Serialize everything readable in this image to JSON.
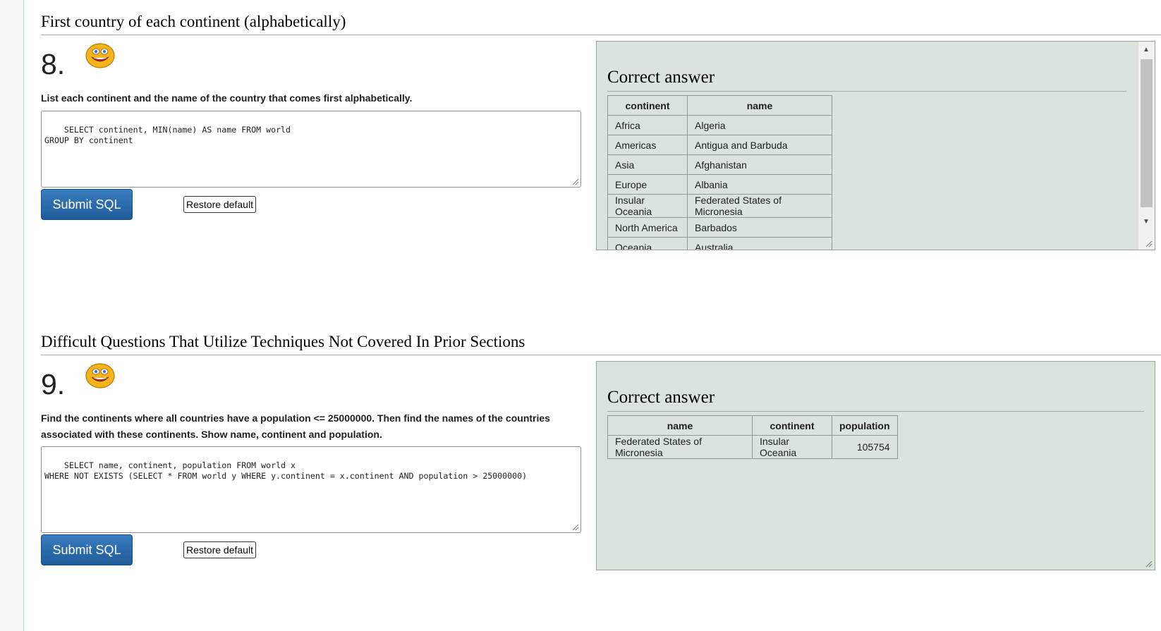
{
  "q8": {
    "heading": "First country of each continent (alphabetically)",
    "number": "8.",
    "question": "List each continent and the name of the country that comes first alphabetically.",
    "sql": "SELECT continent, MIN(name) AS name FROM world\nGROUP BY continent",
    "submit_label": "Submit SQL",
    "restore_label": "Restore default",
    "answer_title": "Correct answer",
    "table": {
      "headers": [
        "continent",
        "name"
      ],
      "rows": [
        [
          "Africa",
          "Algeria"
        ],
        [
          "Americas",
          "Antigua and Barbuda"
        ],
        [
          "Asia",
          "Afghanistan"
        ],
        [
          "Europe",
          "Albania"
        ],
        [
          "Insular Oceania",
          "Federated States of Micronesia"
        ],
        [
          "North America",
          "Barbados"
        ],
        [
          "Oceania",
          "Australia"
        ]
      ]
    }
  },
  "q9": {
    "heading": "Difficult Questions That Utilize Techniques Not Covered In Prior Sections",
    "number": "9.",
    "question": "Find the continents where all countries have a population <= 25000000. Then find the names of the countries associated with these continents. Show name, continent and population.",
    "sql": "SELECT name, continent, population FROM world x\nWHERE NOT EXISTS (SELECT * FROM world y WHERE y.continent = x.continent AND population > 25000000)",
    "submit_label": "Submit SQL",
    "restore_label": "Restore default",
    "answer_title": "Correct answer",
    "table": {
      "headers": [
        "name",
        "continent",
        "population"
      ],
      "rows": [
        [
          "Federated States of Micronesia",
          "Insular Oceania",
          "105754"
        ]
      ]
    }
  },
  "colors": {
    "answer_bg": "#dae3dc",
    "submit_bg": "#2a6aaa",
    "smiley_face": "#f5b51a"
  }
}
